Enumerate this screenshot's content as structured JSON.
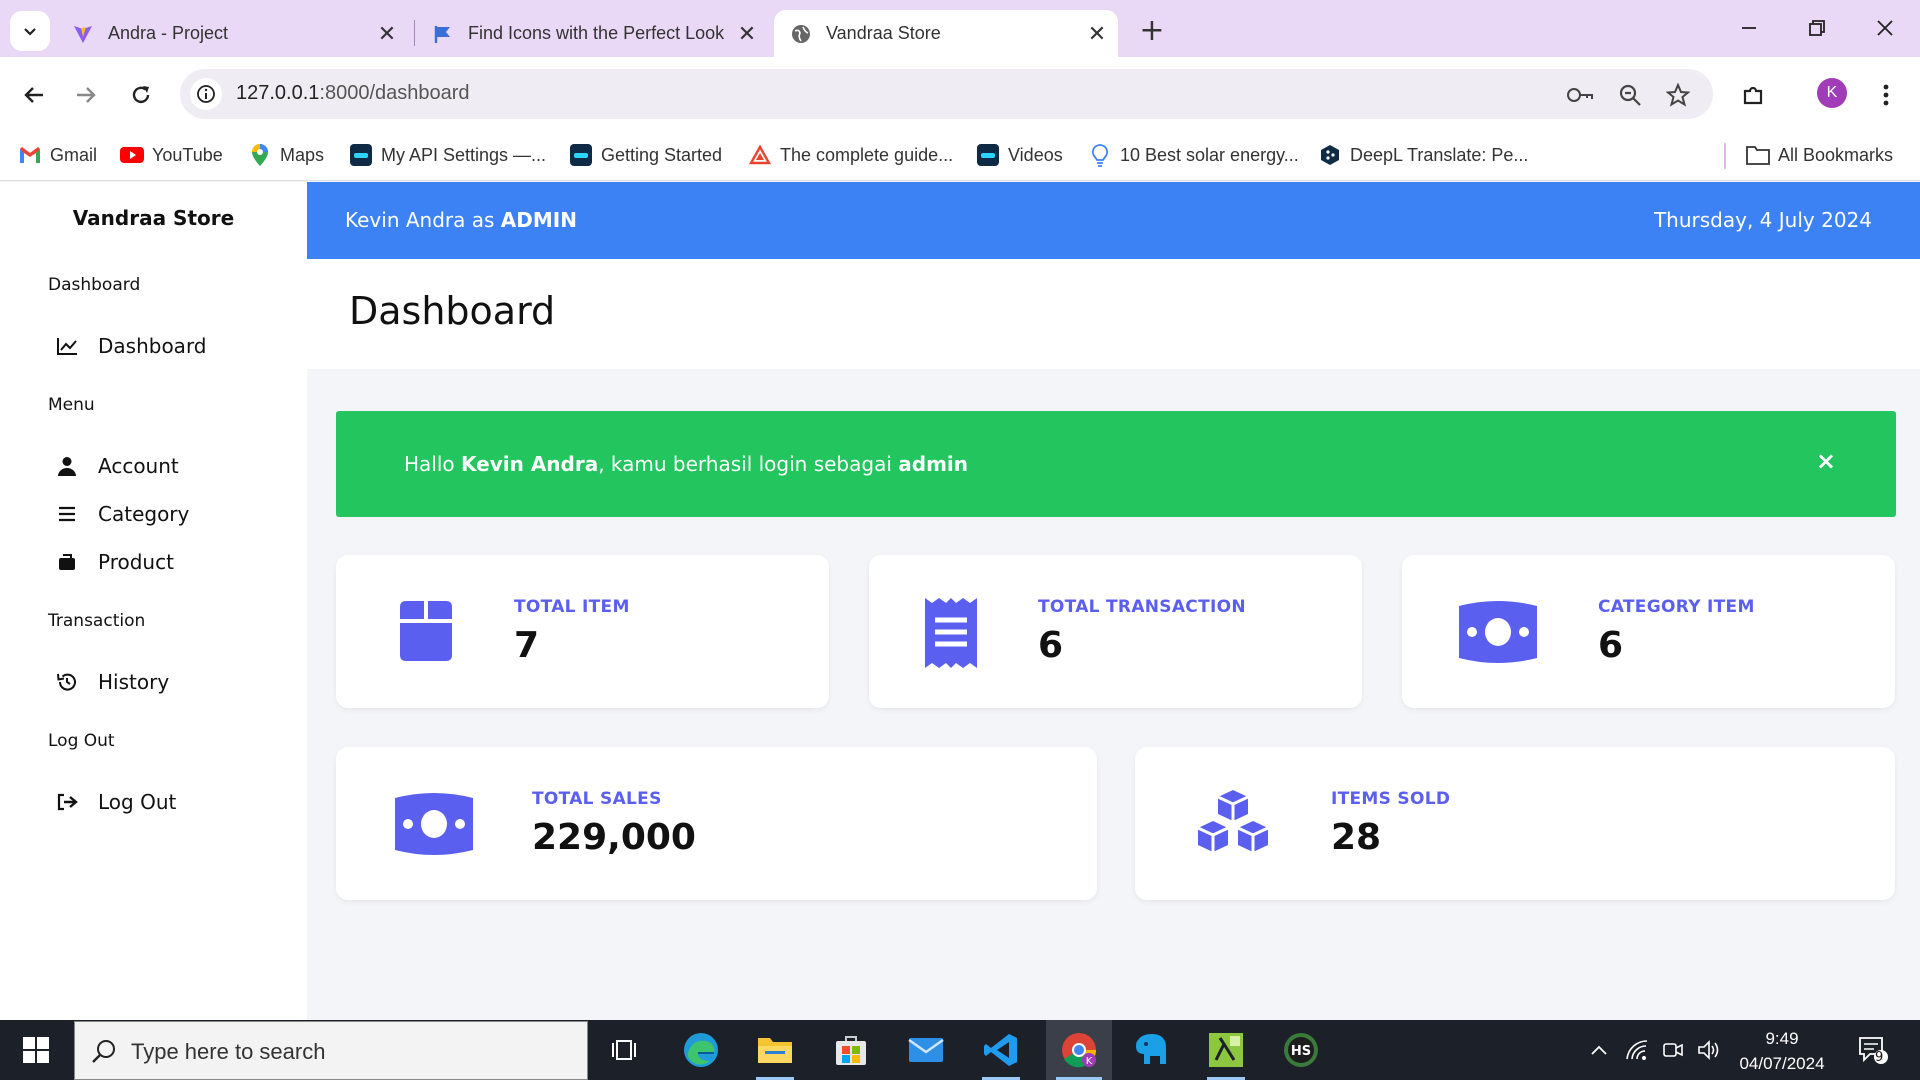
{
  "browser": {
    "tabs": [
      {
        "title": "Andra - Project",
        "icon": "vite-icon"
      },
      {
        "title": "Find Icons with the Perfect Look",
        "icon": "flag-icon"
      },
      {
        "title": "Vandraa Store",
        "icon": "globe-icon",
        "active": true
      }
    ],
    "url_host": "127.0.0.1",
    "url_path": ":8000/dashboard",
    "profile_initial": "K",
    "bookmarks": [
      {
        "label": "Gmail",
        "icon": "gmail-icon"
      },
      {
        "label": "YouTube",
        "icon": "youtube-icon"
      },
      {
        "label": "Maps",
        "icon": "maps-icon"
      },
      {
        "label": "My API Settings —...",
        "icon": "app-icon"
      },
      {
        "label": "Getting Started",
        "icon": "app-icon"
      },
      {
        "label": "The complete guide...",
        "icon": "triangle-icon"
      },
      {
        "label": "Videos",
        "icon": "app-icon"
      },
      {
        "label": "10 Best solar energy...",
        "icon": "bulb-icon"
      },
      {
        "label": "DeepL Translate: Pe...",
        "icon": "deepl-icon"
      }
    ],
    "all_bookmarks": "All Bookmarks"
  },
  "app": {
    "brand": "Vandraa Store",
    "sidebar": {
      "sections": [
        {
          "title": "Dashboard",
          "items": [
            {
              "label": "Dashboard",
              "icon": "chart-line-icon"
            }
          ]
        },
        {
          "title": "Menu",
          "items": [
            {
              "label": "Account",
              "icon": "user-icon"
            },
            {
              "label": "Category",
              "icon": "bars-icon"
            },
            {
              "label": "Product",
              "icon": "briefcase-icon"
            }
          ]
        },
        {
          "title": "Transaction",
          "items": [
            {
              "label": "History",
              "icon": "history-icon"
            }
          ]
        },
        {
          "title": "Log Out",
          "items": [
            {
              "label": "Log Out",
              "icon": "logout-icon"
            }
          ]
        }
      ]
    },
    "topbar": {
      "user_name": "Kevin Andra",
      "as_text": "as",
      "role": "ADMIN",
      "date": "Thursday, 4 July 2024"
    },
    "page_title": "Dashboard",
    "alert": {
      "greeting": "Hallo",
      "name": "Kevin Andra",
      "middle": ", kamu berhasil login sebagai",
      "role": "admin",
      "close": "×"
    },
    "cards": [
      {
        "label": "TOTAL ITEM",
        "value": "7",
        "icon": "box-icon"
      },
      {
        "label": "TOTAL TRANSACTION",
        "value": "6",
        "icon": "receipt-icon"
      },
      {
        "label": "CATEGORY ITEM",
        "value": "6",
        "icon": "money-bill-icon"
      },
      {
        "label": "TOTAL SALES",
        "value": "229,000",
        "icon": "money-bill-icon"
      },
      {
        "label": "ITEMS SOLD",
        "value": "28",
        "icon": "cubes-icon"
      }
    ],
    "accent": "#5b5ff0",
    "topbar_color": "#3c82f5",
    "alert_color": "#22c55e"
  },
  "taskbar": {
    "search_placeholder": "Type here to search",
    "time": "9:49",
    "date": "04/07/2024",
    "notification_count": "9"
  }
}
